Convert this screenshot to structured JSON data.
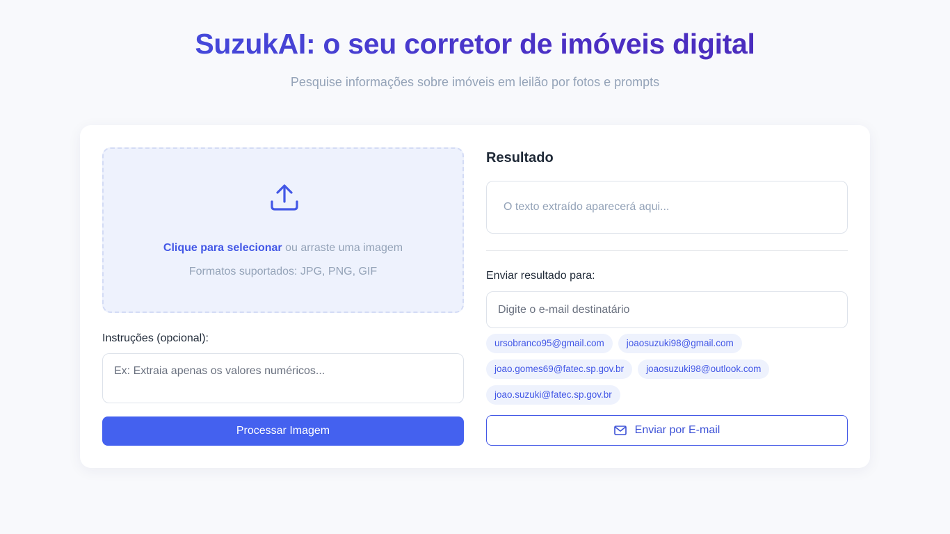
{
  "header": {
    "title": "SuzukAI: o seu corretor de imóveis digital",
    "subtitle": "Pesquise informações sobre imóveis em leilão por fotos e prompts"
  },
  "upload": {
    "icon": "upload-icon",
    "link_text": "Clique para selecionar",
    "rest_text": " ou arraste uma imagem",
    "formats": "Formatos suportados: JPG, PNG, GIF"
  },
  "instructions": {
    "label": "Instruções (opcional):",
    "placeholder": "Ex: Extraia apenas os valores numéricos..."
  },
  "process_button": "Processar Imagem",
  "result": {
    "title": "Resultado",
    "placeholder": "O texto extraído aparecerá aqui..."
  },
  "send": {
    "label": "Enviar resultado para:",
    "placeholder": "Digite o e-mail destinatário",
    "suggestions": [
      "ursobranco95@gmail.com",
      "joaosuzuki98@gmail.com",
      "joao.gomes69@fatec.sp.gov.br",
      "joaosuzuki98@outlook.com",
      "joao.suzuki@fatec.sp.gov.br"
    ],
    "button": "Enviar por E-mail",
    "button_icon": "mail-icon"
  },
  "colors": {
    "accent": "#4461ef",
    "title_gradient_start": "#4257e6",
    "title_gradient_end": "#4a2bb8",
    "background": "#f8f9fc"
  }
}
